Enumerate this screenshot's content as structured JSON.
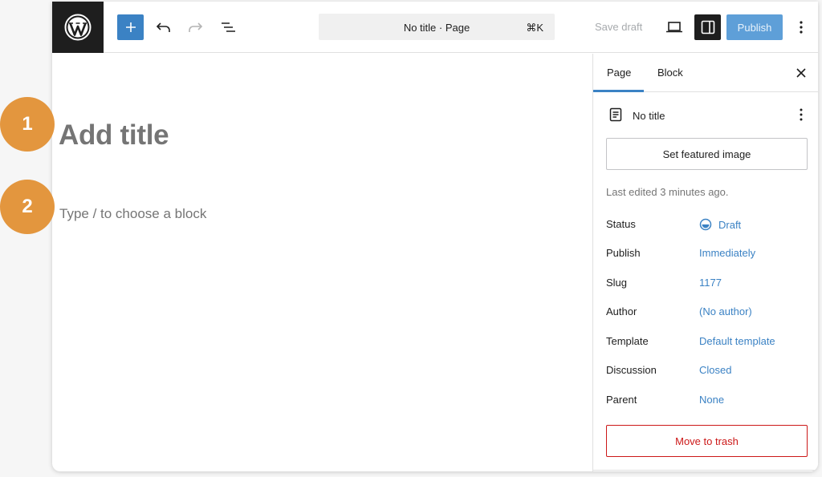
{
  "topbar": {
    "add_block_label": "+",
    "command_title": "No title · Page",
    "command_shortcut": "⌘K",
    "save_draft_label": "Save draft",
    "publish_label": "Publish",
    "icons": [
      "wordpress-logo",
      "plus-icon",
      "undo-icon",
      "redo-icon",
      "list-view-icon",
      "desktop-preview-icon",
      "settings-sidebar-icon",
      "options-icon"
    ]
  },
  "editor": {
    "title_placeholder": "Add title",
    "block_placeholder": "Type / to choose a block"
  },
  "sidebar": {
    "tabs": [
      {
        "label": "Page",
        "active": true
      },
      {
        "label": "Block",
        "active": false
      }
    ],
    "document_title": "No title",
    "featured_image_label": "Set featured image",
    "last_edited": "Last edited 3 minutes ago.",
    "meta": [
      {
        "label": "Status",
        "value": "Draft"
      },
      {
        "label": "Publish",
        "value": "Immediately"
      },
      {
        "label": "Slug",
        "value": "1177"
      },
      {
        "label": "Author",
        "value": "(No author)"
      },
      {
        "label": "Template",
        "value": "Default template"
      },
      {
        "label": "Discussion",
        "value": "Closed"
      },
      {
        "label": "Parent",
        "value": "None"
      }
    ],
    "trash_label": "Move to trash"
  },
  "callouts": [
    {
      "number": "1"
    },
    {
      "number": "2"
    }
  ],
  "colors": {
    "accent": "#3b82c4",
    "publish_bg": "#5e9fd8",
    "danger": "#cc1818",
    "callout": "#e3963e",
    "dark": "#1e1e1e"
  }
}
